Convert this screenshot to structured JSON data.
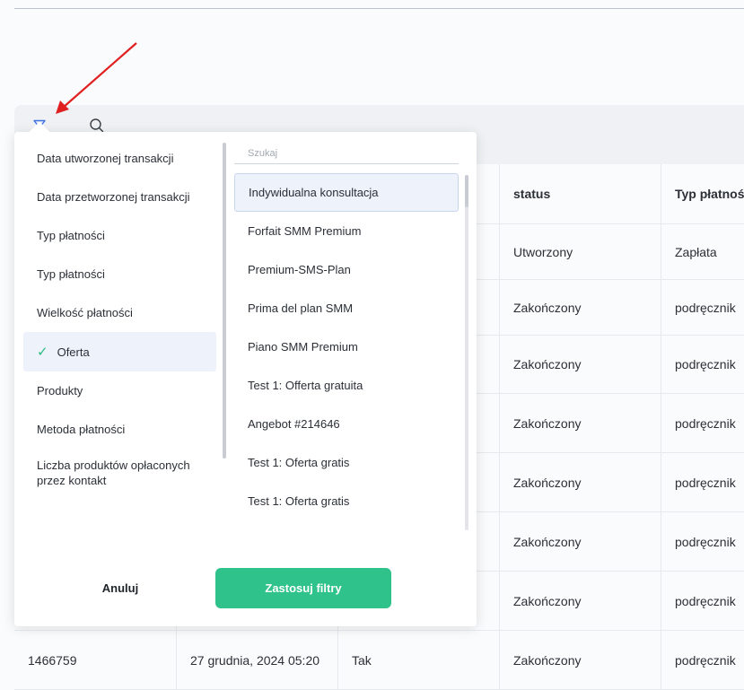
{
  "toolbar": {
    "filter_icon": "filter-funnel-icon",
    "search_icon": "search-icon"
  },
  "table": {
    "headers": {
      "status": "status",
      "type": "Typ płatnoś"
    },
    "rows": [
      {
        "id": "",
        "date": "",
        "flag": "",
        "status": "Utworzony",
        "type": "Zapłata"
      },
      {
        "id": "",
        "date": "",
        "flag": "",
        "status": "Zakończony",
        "type": "podręcznik"
      },
      {
        "id": "",
        "date": "",
        "flag": "",
        "status": "Zakończony",
        "type": "podręcznik"
      },
      {
        "id": "",
        "date": "",
        "flag": "",
        "status": "Zakończony",
        "type": "podręcznik"
      },
      {
        "id": "",
        "date": "",
        "flag": "",
        "status": "Zakończony",
        "type": "podręcznik"
      },
      {
        "id": "",
        "date": "",
        "flag": "",
        "status": "Zakończony",
        "type": "podręcznik"
      },
      {
        "id": "",
        "date": "",
        "flag": "",
        "status": "Zakończony",
        "type": "podręcznik"
      },
      {
        "id": "1466759",
        "date": "27 grudnia, 2024 05:20",
        "flag": "Tak",
        "status": "Zakończony",
        "type": "podręcznik"
      }
    ]
  },
  "filter_panel": {
    "categories": [
      {
        "label": "Data utworzonej transakcji"
      },
      {
        "label": "Data przetworzonej transakcji"
      },
      {
        "label": "Typ płatności"
      },
      {
        "label": "Typ płatności"
      },
      {
        "label": "Wielkość płatności"
      },
      {
        "label": "Oferta",
        "active": true
      },
      {
        "label": "Produkty"
      },
      {
        "label": "Metoda płatności"
      },
      {
        "label": "Liczba produktów opłaconych przez kontakt"
      }
    ],
    "check_mark": "✓",
    "search_placeholder": "Szukaj",
    "options": [
      {
        "label": "Indywidualna konsultacja",
        "selected": true
      },
      {
        "label": "Forfait SMM Premium"
      },
      {
        "label": "Premium-SMS-Plan"
      },
      {
        "label": "Prima del plan SMM"
      },
      {
        "label": "Piano SMM Premium"
      },
      {
        "label": "Test 1: Offerta gratuita"
      },
      {
        "label": "Angebot #214646"
      },
      {
        "label": "Test 1: Oferta gratis"
      },
      {
        "label": "Test 1: Oferta gratis"
      }
    ],
    "cancel_label": "Anuluj",
    "apply_label": "Zastosuj filtry"
  },
  "colors": {
    "accent_green": "#2fc28a",
    "active_blue": "#3e6fe0",
    "arrow_red": "#e02020"
  }
}
